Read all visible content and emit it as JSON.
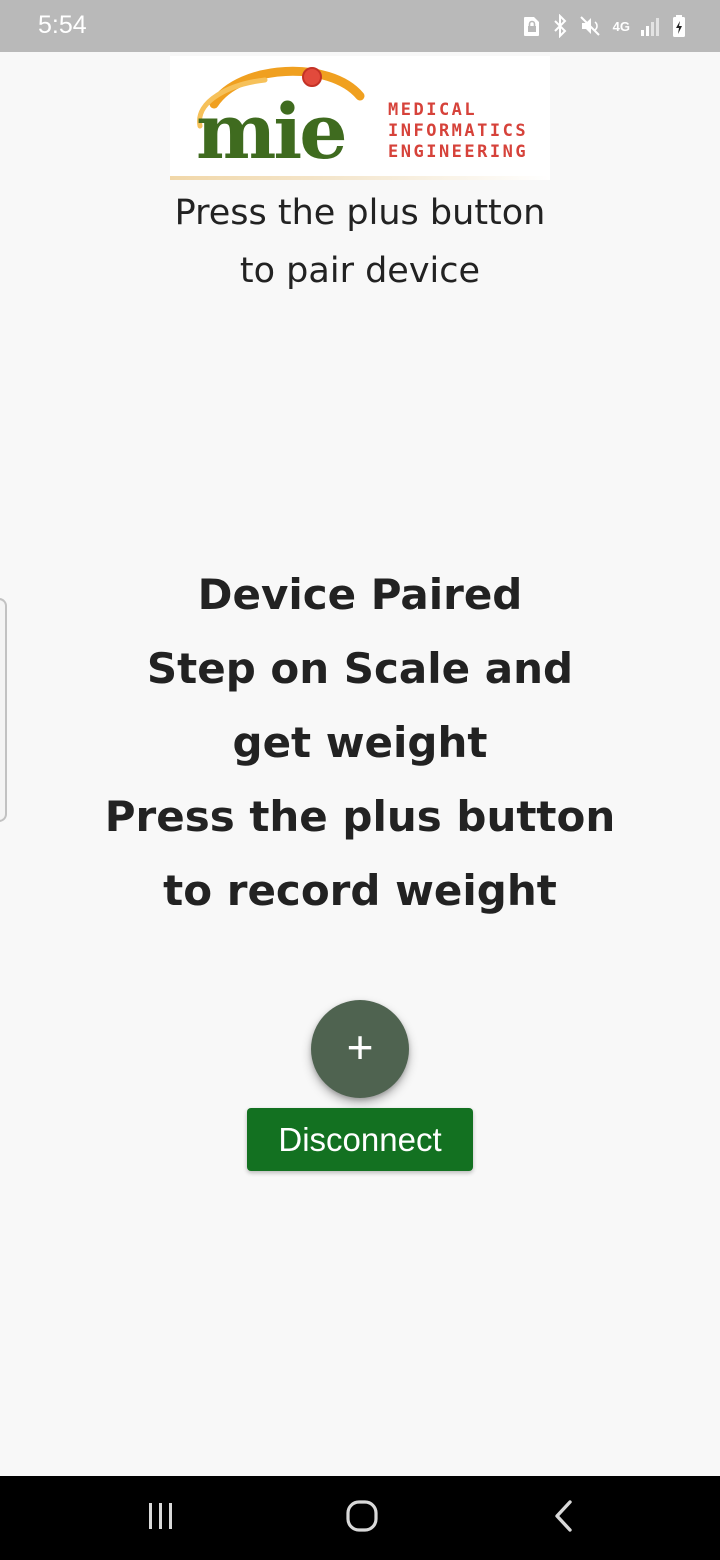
{
  "status_bar": {
    "time": "5:54",
    "network_label": "4G",
    "icons": [
      "sim-lock-icon",
      "bluetooth-icon",
      "mute-icon",
      "network-4g-icon",
      "signal-icon",
      "battery-charging-icon"
    ]
  },
  "logo": {
    "wordmark": "mie",
    "lines": [
      "MEDICAL",
      "INFORMATICS",
      "ENGINEERING"
    ],
    "colors": {
      "wordmark": "#3f6b1f",
      "text": "#d6423a",
      "orbit": "#f0a020"
    }
  },
  "pair_instructions": [
    "Press the plus button",
    "to pair device"
  ],
  "paired_status": [
    "Device Paired",
    "Step on Scale and",
    "get weight",
    "Press the plus button",
    "to record weight"
  ],
  "fab": {
    "icon": "plus-icon",
    "symbol": "+",
    "color": "#4f6350"
  },
  "disconnect_button": {
    "label": "Disconnect",
    "color": "#137121"
  },
  "nav_bar": {
    "icons": [
      "recent-apps-icon",
      "home-icon",
      "back-icon"
    ]
  }
}
